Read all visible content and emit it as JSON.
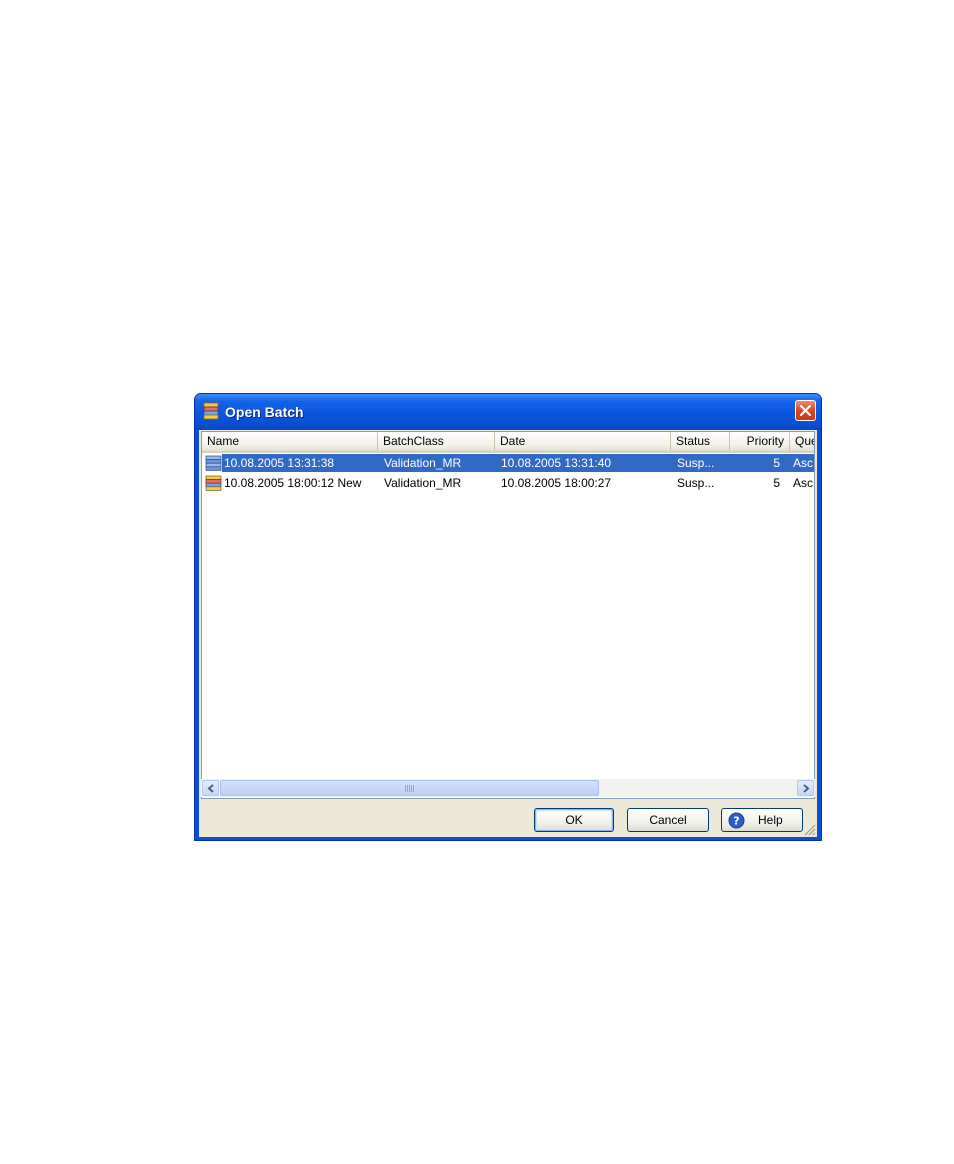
{
  "window": {
    "title": "Open Batch"
  },
  "columns": [
    {
      "label": "Name"
    },
    {
      "label": "BatchClass"
    },
    {
      "label": "Date"
    },
    {
      "label": "Status"
    },
    {
      "label": "Priority"
    },
    {
      "label": "Que"
    }
  ],
  "rows": [
    {
      "name": "10.08.2005 13:31:38",
      "batch_class": "Validation_MR",
      "date": "10.08.2005 13:31:40",
      "status": "Susp...",
      "priority": "5",
      "queue": "Asc",
      "selected": true
    },
    {
      "name": "10.08.2005 18:00:12 New",
      "batch_class": "Validation_MR",
      "date": "10.08.2005 18:00:27",
      "status": "Susp...",
      "priority": "5",
      "queue": "Asc",
      "selected": false
    }
  ],
  "buttons": {
    "ok": "OK",
    "cancel": "Cancel",
    "help": "Help"
  },
  "colors": {
    "title_blue": "#0a4fd3",
    "selection": "#316ac5",
    "close_red": "#d9471f",
    "dialog_face": "#ece9d8"
  },
  "icons": {
    "title": "batch-stack-icon",
    "row": "batch-stack-icon",
    "close": "close-icon",
    "help": "help-icon"
  }
}
